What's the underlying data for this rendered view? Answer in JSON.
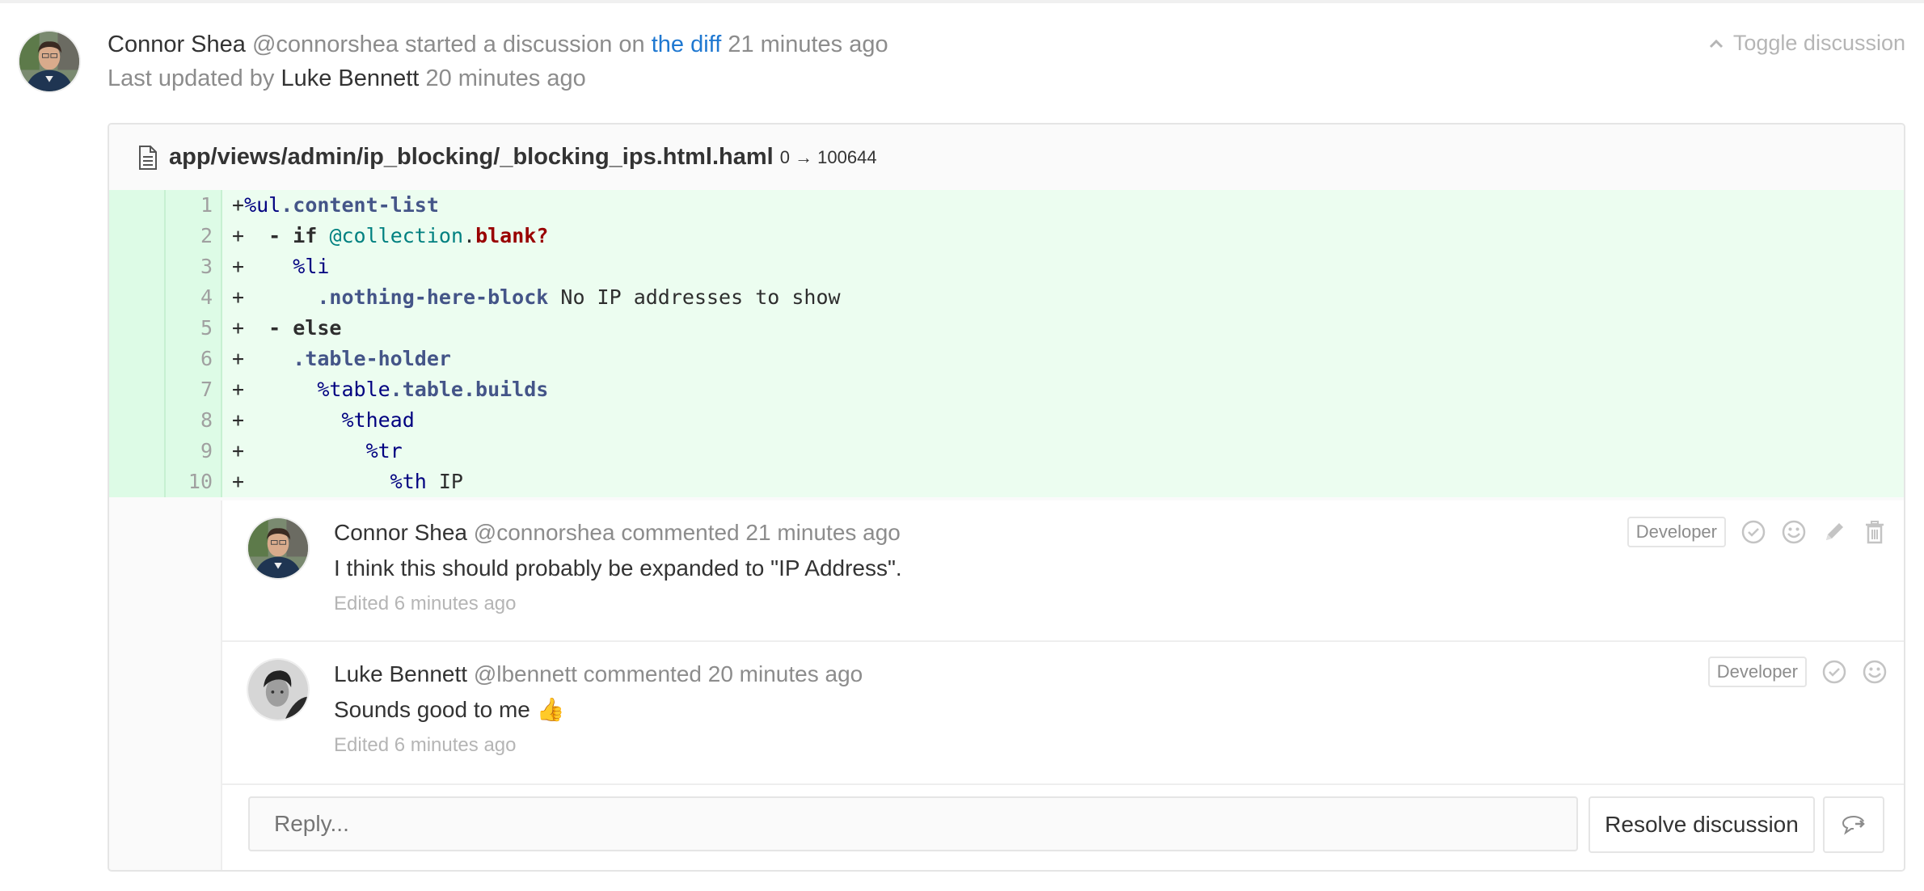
{
  "discussion": {
    "author_name": "Connor Shea",
    "author_handle": "@connorshea",
    "started_text": "started a discussion on",
    "diff_link": "the diff",
    "started_time": "21 minutes ago",
    "last_updated_prefix": "Last updated by",
    "last_updated_by": "Luke Bennett",
    "last_updated_time": "20 minutes ago",
    "toggle_label": "Toggle discussion",
    "toggle_icon": "chevron-up-icon"
  },
  "file": {
    "icon": "file-text-icon",
    "path": "app/views/admin/ip_blocking/_blocking_ips.html.haml",
    "mode_change": "0 → 100644"
  },
  "diff_lines": [
    {
      "num": "1",
      "tokens": [
        [
          "plain",
          "+"
        ],
        [
          "tag",
          "%ul"
        ],
        [
          "class",
          ".content-list"
        ]
      ]
    },
    {
      "num": "2",
      "tokens": [
        [
          "plain",
          "+  "
        ],
        [
          "kw",
          "- if"
        ],
        [
          "plain",
          " "
        ],
        [
          "ivar",
          "@collection"
        ],
        [
          "plain",
          "."
        ],
        [
          "method",
          "blank?"
        ]
      ]
    },
    {
      "num": "3",
      "tokens": [
        [
          "plain",
          "+    "
        ],
        [
          "tag",
          "%li"
        ]
      ]
    },
    {
      "num": "4",
      "tokens": [
        [
          "plain",
          "+      "
        ],
        [
          "class",
          ".nothing-here-block"
        ],
        [
          "plain",
          " No IP addresses to show"
        ]
      ]
    },
    {
      "num": "5",
      "tokens": [
        [
          "plain",
          "+  "
        ],
        [
          "kw",
          "- else"
        ]
      ]
    },
    {
      "num": "6",
      "tokens": [
        [
          "plain",
          "+    "
        ],
        [
          "class",
          ".table-holder"
        ]
      ]
    },
    {
      "num": "7",
      "tokens": [
        [
          "plain",
          "+      "
        ],
        [
          "tag",
          "%table"
        ],
        [
          "class",
          ".table.builds"
        ]
      ]
    },
    {
      "num": "8",
      "tokens": [
        [
          "plain",
          "+        "
        ],
        [
          "tag",
          "%thead"
        ]
      ]
    },
    {
      "num": "9",
      "tokens": [
        [
          "plain",
          "+          "
        ],
        [
          "tag",
          "%tr"
        ]
      ]
    },
    {
      "num": "10",
      "tokens": [
        [
          "plain",
          "+            "
        ],
        [
          "tag",
          "%th"
        ],
        [
          "plain",
          " IP"
        ]
      ]
    }
  ],
  "notes": [
    {
      "author_name": "Connor Shea",
      "author_handle": "@connorshea",
      "action": "commented",
      "time": "21 minutes ago",
      "text": "I think this should probably be expanded to \"IP Address\".",
      "edited": "Edited 6 minutes ago",
      "role": "Developer",
      "actions": [
        "resolve-icon",
        "emoji-icon",
        "edit-icon",
        "delete-icon"
      ]
    },
    {
      "author_name": "Luke Bennett",
      "author_handle": "@lbennett",
      "action": "commented",
      "time": "20 minutes ago",
      "text": "Sounds good to me",
      "emoji": "👍",
      "edited": "Edited 6 minutes ago",
      "role": "Developer",
      "actions": [
        "resolve-icon",
        "emoji-icon"
      ]
    }
  ],
  "reply": {
    "placeholder": "Reply...",
    "value": "",
    "resolve_label": "Resolve discussion",
    "new_discussion_icon": "comment-arrow-icon"
  },
  "colors": {
    "link": "#1f78d1",
    "added_line_bg": "#ecfdf0",
    "added_gutter_bg": "#ddfbe6"
  }
}
